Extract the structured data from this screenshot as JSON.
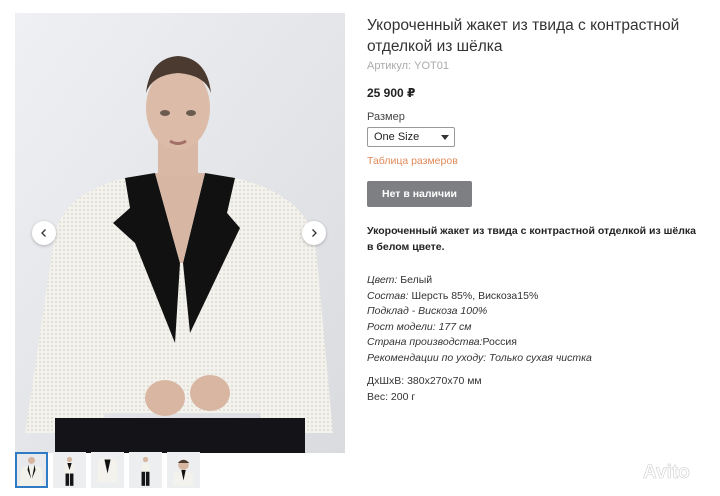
{
  "gallery": {
    "prev_icon": "chevron-left-icon",
    "next_icon": "chevron-right-icon",
    "thumbnails": [
      "thumb-1",
      "thumb-2",
      "thumb-3",
      "thumb-4",
      "thumb-5"
    ],
    "active_thumbnail": 0
  },
  "product": {
    "title": "Укороченный жакет из твида с контрастной отделкой из шёлка",
    "sku_label": "Артикул:",
    "sku": "YOT01",
    "price": "25 900 ₽",
    "size_label": "Размер",
    "size_selected": "One Size",
    "size_table_link": "Таблица размеров",
    "stock_button": "Нет в наличии",
    "description": "Укороченный жакет из твида с контрастной отделкой из шёлка в белом цвете."
  },
  "specs": {
    "color_key": "Цвет:",
    "color_val": " Белый",
    "composition_key": "Состав:",
    "composition_val": " Шерсть 85%, Вискоза15%",
    "lining": "Подклад - Вискоза 100%",
    "model_height": "Рост модели: 177 см",
    "country_key": "Страна производства:",
    "country_val": "Россия",
    "care_key": "Рекомендации по уходу:",
    "care_val": " Только сухая чистка",
    "dimensions": "ДхШхВ: 380х270х70 мм",
    "weight": "Вес: 200 г"
  },
  "watermark": {
    "text": "Avito"
  },
  "colors": {
    "button_bg": "#7d7f83",
    "link": "#e08a5a",
    "thumb_active": "#2f7cc4"
  }
}
